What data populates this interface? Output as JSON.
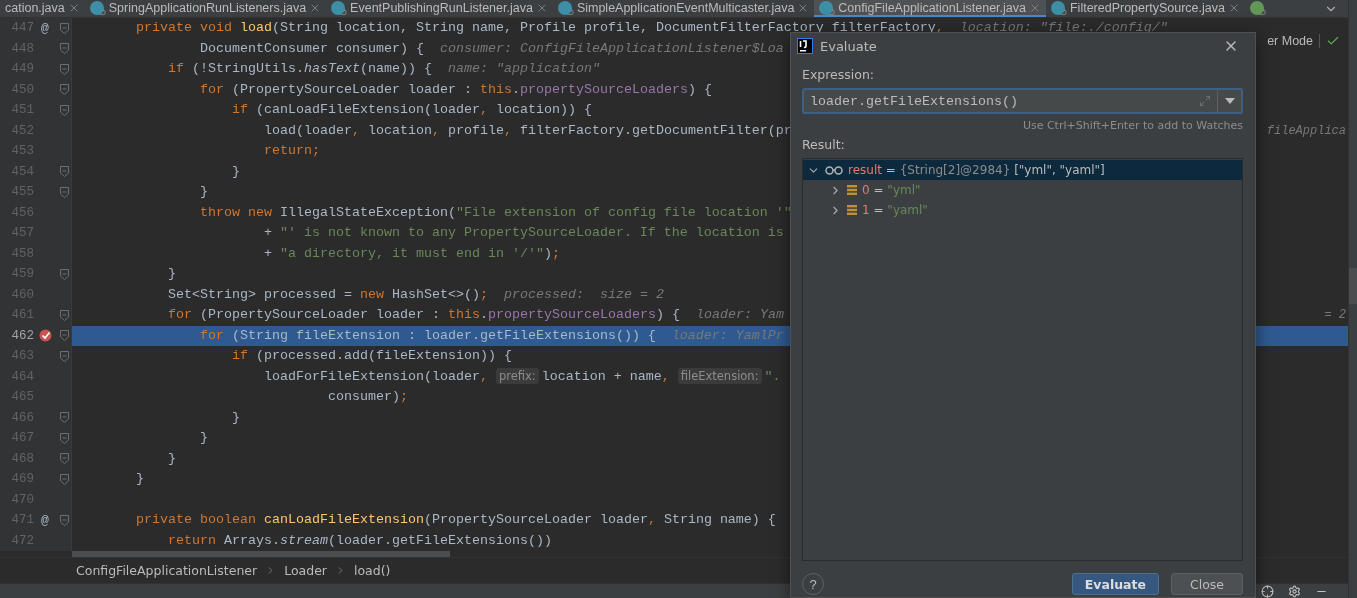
{
  "tabs": [
    {
      "label": "cation.java",
      "kind": "plain",
      "selected": false
    },
    {
      "label": "SpringApplicationRunListeners.java",
      "kind": "class",
      "locked": true,
      "selected": false
    },
    {
      "label": "EventPublishingRunListener.java",
      "kind": "class",
      "locked": true,
      "selected": false
    },
    {
      "label": "SimpleApplicationEventMulticaster.java",
      "kind": "class",
      "locked": true,
      "selected": false
    },
    {
      "label": "ConfigFileApplicationListener.java",
      "kind": "class",
      "locked": true,
      "selected": true
    },
    {
      "label": "FilteredPropertySource.java",
      "kind": "class",
      "locked": true,
      "selected": false
    },
    {
      "kind": "interface",
      "locked": true,
      "selected": false
    }
  ],
  "editor": {
    "lines": [
      {
        "number": "447",
        "gutter_mark": "@",
        "fold": true,
        "breakpoint": false,
        "current": false,
        "code": [
          {
            "kind": "keyword",
            "text": "        private void "
          },
          {
            "kind": "method",
            "text": "load"
          },
          {
            "kind": "plain",
            "text": "(String location, String name, Profile profile, DocumentFilterFactory filterFactory"
          },
          {
            "kind": "punct",
            "text": ","
          },
          {
            "kind": "hint",
            "text": "  location: \"file:./config/\""
          }
        ]
      },
      {
        "number": "448",
        "fold": true,
        "breakpoint": false,
        "current": false,
        "code": [
          {
            "kind": "plain",
            "text": "                DocumentConsumer consumer) {"
          },
          {
            "kind": "hint",
            "text": "  consumer: ConfigFileApplicationListener$Loa"
          }
        ],
        "aside": {
          "kind": "reader",
          "text": "er Mode"
        }
      },
      {
        "number": "449",
        "fold": true,
        "breakpoint": false,
        "current": false,
        "code": [
          {
            "kind": "keyword",
            "text": "            if "
          },
          {
            "kind": "plain",
            "text": "(!StringUtils."
          },
          {
            "kind": "italic",
            "text": "hasText"
          },
          {
            "kind": "plain",
            "text": "(name)) {"
          },
          {
            "kind": "hint",
            "text": "  name: \"application\""
          }
        ]
      },
      {
        "number": "450",
        "fold": true,
        "breakpoint": false,
        "current": false,
        "code": [
          {
            "kind": "keyword",
            "text": "                for "
          },
          {
            "kind": "plain",
            "text": "(PropertySourceLoader loader : "
          },
          {
            "kind": "keyword",
            "text": "this"
          },
          {
            "kind": "plain",
            "text": "."
          },
          {
            "kind": "field",
            "text": "propertySourceLoaders"
          },
          {
            "kind": "plain",
            "text": ") {"
          }
        ]
      },
      {
        "number": "451",
        "fold": true,
        "breakpoint": false,
        "current": false,
        "code": [
          {
            "kind": "keyword",
            "text": "                    if "
          },
          {
            "kind": "plain",
            "text": "(canLoadFileExtension(loader"
          },
          {
            "kind": "punct",
            "text": ","
          },
          {
            "kind": "plain",
            "text": " location)) {"
          }
        ]
      },
      {
        "number": "452",
        "fold": false,
        "breakpoint": false,
        "current": false,
        "code": [
          {
            "kind": "plain",
            "text": "                        load(loader"
          },
          {
            "kind": "punct",
            "text": ","
          },
          {
            "kind": "plain",
            "text": " location"
          },
          {
            "kind": "punct",
            "text": ","
          },
          {
            "kind": "plain",
            "text": " profile"
          },
          {
            "kind": "punct",
            "text": ","
          },
          {
            "kind": "plain",
            "text": " filterFactory.getDocumentFilter(pr"
          }
        ],
        "aside": {
          "kind": "hint",
          "text": "fileApplica"
        }
      },
      {
        "number": "453",
        "fold": false,
        "breakpoint": false,
        "current": false,
        "code": [
          {
            "kind": "keyword",
            "text": "                        return"
          },
          {
            "kind": "punct",
            "text": ";"
          }
        ]
      },
      {
        "number": "454",
        "fold": true,
        "breakpoint": false,
        "current": false,
        "code": [
          {
            "kind": "plain",
            "text": "                    }"
          }
        ]
      },
      {
        "number": "455",
        "fold": true,
        "breakpoint": false,
        "current": false,
        "code": [
          {
            "kind": "plain",
            "text": "                }"
          }
        ]
      },
      {
        "number": "456",
        "fold": false,
        "breakpoint": false,
        "current": false,
        "code": [
          {
            "kind": "keyword",
            "text": "                throw new "
          },
          {
            "kind": "plain",
            "text": "IllegalStateException("
          },
          {
            "kind": "string",
            "text": "\"File extension of config file location '\""
          }
        ]
      },
      {
        "number": "457",
        "fold": false,
        "breakpoint": false,
        "current": false,
        "code": [
          {
            "kind": "plain",
            "text": "                        + "
          },
          {
            "kind": "string",
            "text": "\"' is not known to any PropertySourceLoader. If the location is"
          }
        ]
      },
      {
        "number": "458",
        "fold": false,
        "breakpoint": false,
        "current": false,
        "code": [
          {
            "kind": "plain",
            "text": "                        + "
          },
          {
            "kind": "string",
            "text": "\"a directory, it must end in '/'\""
          },
          {
            "kind": "plain",
            "text": ")"
          },
          {
            "kind": "punct",
            "text": ";"
          }
        ]
      },
      {
        "number": "459",
        "fold": true,
        "breakpoint": false,
        "current": false,
        "code": [
          {
            "kind": "plain",
            "text": "            }"
          }
        ]
      },
      {
        "number": "460",
        "fold": false,
        "breakpoint": false,
        "current": false,
        "code": [
          {
            "kind": "plain",
            "text": "            Set<String> processed = "
          },
          {
            "kind": "keyword",
            "text": "new "
          },
          {
            "kind": "plain",
            "text": "HashSet<>()"
          },
          {
            "kind": "punct",
            "text": ";"
          },
          {
            "kind": "hint",
            "text": "  processed:  size = 2"
          }
        ]
      },
      {
        "number": "461",
        "fold": true,
        "breakpoint": false,
        "current": false,
        "code": [
          {
            "kind": "keyword",
            "text": "            for "
          },
          {
            "kind": "plain",
            "text": "(PropertySourceLoader loader : "
          },
          {
            "kind": "keyword",
            "text": "this"
          },
          {
            "kind": "plain",
            "text": "."
          },
          {
            "kind": "field",
            "text": "propertySourceLoaders"
          },
          {
            "kind": "plain",
            "text": ") {"
          },
          {
            "kind": "hint",
            "text": "  loader: Yam"
          }
        ],
        "aside": {
          "kind": "hint",
          "text": "= 2"
        }
      },
      {
        "number": "462",
        "fold": true,
        "breakpoint": true,
        "current": true,
        "code": [
          {
            "kind": "keyword",
            "text": "                for "
          },
          {
            "kind": "plain",
            "text": "(String fileExtension : loader.getFileExtensions()) {"
          },
          {
            "kind": "hint",
            "text": "  loader: YamlPr"
          }
        ]
      },
      {
        "number": "463",
        "fold": true,
        "breakpoint": false,
        "current": false,
        "code": [
          {
            "kind": "keyword",
            "text": "                    if "
          },
          {
            "kind": "plain",
            "text": "(processed.add(fileExtension)) {"
          }
        ]
      },
      {
        "number": "464",
        "fold": false,
        "breakpoint": false,
        "current": false,
        "code": [
          {
            "kind": "plain",
            "text": "                        loadForFileExtension(loader"
          },
          {
            "kind": "punct",
            "text": ", "
          },
          {
            "kind": "inlay",
            "text": "prefix:"
          },
          {
            "kind": "plain",
            "text": "location + name"
          },
          {
            "kind": "punct",
            "text": ", "
          },
          {
            "kind": "inlay",
            "text": "fileExtension:"
          },
          {
            "kind": "string",
            "text": "\"."
          }
        ]
      },
      {
        "number": "465",
        "fold": false,
        "breakpoint": false,
        "current": false,
        "code": [
          {
            "kind": "plain",
            "text": "                                consumer)"
          },
          {
            "kind": "punct",
            "text": ";"
          }
        ]
      },
      {
        "number": "466",
        "fold": true,
        "breakpoint": false,
        "current": false,
        "code": [
          {
            "kind": "plain",
            "text": "                    }"
          }
        ]
      },
      {
        "number": "467",
        "fold": true,
        "breakpoint": false,
        "current": false,
        "code": [
          {
            "kind": "plain",
            "text": "                }"
          }
        ]
      },
      {
        "number": "468",
        "fold": true,
        "breakpoint": false,
        "current": false,
        "code": [
          {
            "kind": "plain",
            "text": "            }"
          }
        ]
      },
      {
        "number": "469",
        "fold": true,
        "breakpoint": false,
        "current": false,
        "code": [
          {
            "kind": "plain",
            "text": "        }"
          }
        ]
      },
      {
        "number": "470",
        "fold": false,
        "breakpoint": false,
        "current": false
      },
      {
        "number": "471",
        "gutter_mark": "@",
        "fold": true,
        "breakpoint": false,
        "current": false,
        "code": [
          {
            "kind": "keyword",
            "text": "        private boolean "
          },
          {
            "kind": "method",
            "text": "canLoadFileExtension"
          },
          {
            "kind": "plain",
            "text": "(PropertySourceLoader loader"
          },
          {
            "kind": "punct",
            "text": ","
          },
          {
            "kind": "plain",
            "text": " String name) {"
          }
        ]
      },
      {
        "number": "472",
        "fold": false,
        "breakpoint": false,
        "current": false,
        "code": [
          {
            "kind": "keyword",
            "text": "            return "
          },
          {
            "kind": "plain",
            "text": "Arrays."
          },
          {
            "kind": "italic",
            "text": "stream"
          },
          {
            "kind": "plain",
            "text": "(loader.getFileExtensions())"
          }
        ]
      }
    ]
  },
  "breadcrumb": [
    "ConfigFileApplicationListener",
    "Loader",
    "load()"
  ],
  "dialog": {
    "title": "Evaluate",
    "expression_label": "Expression:",
    "expression": "loader.getFileExtensions()",
    "hint": "Use Ctrl+Shift+Enter to add to Watches",
    "result_label": "Result:",
    "result": {
      "name": "result",
      "operator": "=",
      "type": "{String[2]@2984}",
      "value": "[\"yml\", \"yaml\"]",
      "expanded": true,
      "selected": true,
      "children": [
        {
          "name": "0",
          "operator": "=",
          "value": "\"yml\"",
          "expanded": false,
          "selected": false
        },
        {
          "name": "1",
          "operator": "=",
          "value": "\"yaml\"",
          "expanded": false,
          "selected": false
        }
      ]
    },
    "help": "?",
    "buttons": [
      {
        "label": "Evaluate",
        "kind": "primary"
      },
      {
        "label": "Close",
        "kind": "secondary"
      }
    ]
  }
}
